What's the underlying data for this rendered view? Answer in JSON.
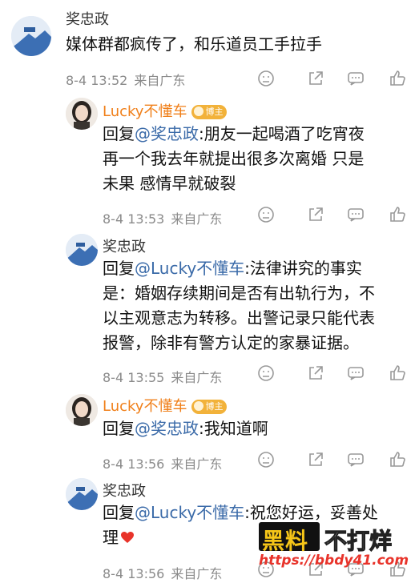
{
  "comments": [
    {
      "username": "奖忠政",
      "avatar": "landscape-avatar",
      "lines": [
        "媒体群都疯传了，和乐道员工手拉手"
      ],
      "time": "8-4 13:52",
      "source": "来自广东"
    },
    {
      "username": "Lucky不懂车",
      "avatar": "woman-avatar",
      "badge": "博主",
      "reply_prefix": "回复",
      "mention": "@奖忠政",
      "lines": [
        ":朋友一起喝酒了吃宵夜",
        "再一个我去年就提出很多次离婚 只是",
        "未果 感情早就破裂"
      ],
      "time": "8-4 13:53",
      "source": "来自广东"
    },
    {
      "username": "奖忠政",
      "avatar": "landscape-avatar",
      "reply_prefix": "回复",
      "mention": "@Lucky不懂车",
      "lines": [
        ":法律讲究的事实",
        "是：婚姻存续期间是否有出轨行为，不",
        "以主观意志为转移。出警记录只能代表",
        "报警，除非有警方认定的家暴证据。"
      ],
      "time": "8-4 13:55",
      "source": "来自广东"
    },
    {
      "username": "Lucky不懂车",
      "avatar": "woman-avatar",
      "badge": "博主",
      "reply_prefix": "回复",
      "mention": "@奖忠政",
      "lines": [
        ":我知道啊"
      ],
      "time": "8-4 13:56",
      "source": "来自广东"
    },
    {
      "username": "奖忠政",
      "avatar": "landscape-avatar",
      "reply_prefix": "回复",
      "mention": "@Lucky不懂车",
      "lines": [
        ":祝您好运，妥善处",
        "理"
      ],
      "emoji": "heart-icon",
      "time": "8-4 13:56",
      "source": "来自广东"
    }
  ],
  "actions": [
    "dislike-icon",
    "share-icon",
    "comment-icon",
    "like-icon"
  ],
  "watermark": {
    "main": "黑料",
    "sub": "不打烊",
    "url": "https://bbdy41.com"
  },
  "colors": {
    "username_orange": "#f07f19",
    "mention_blue": "#3a6aa8",
    "meta_gray": "#8a8a8a",
    "badge_gold": "#f2b23a",
    "heart_red": "#e8332a"
  }
}
